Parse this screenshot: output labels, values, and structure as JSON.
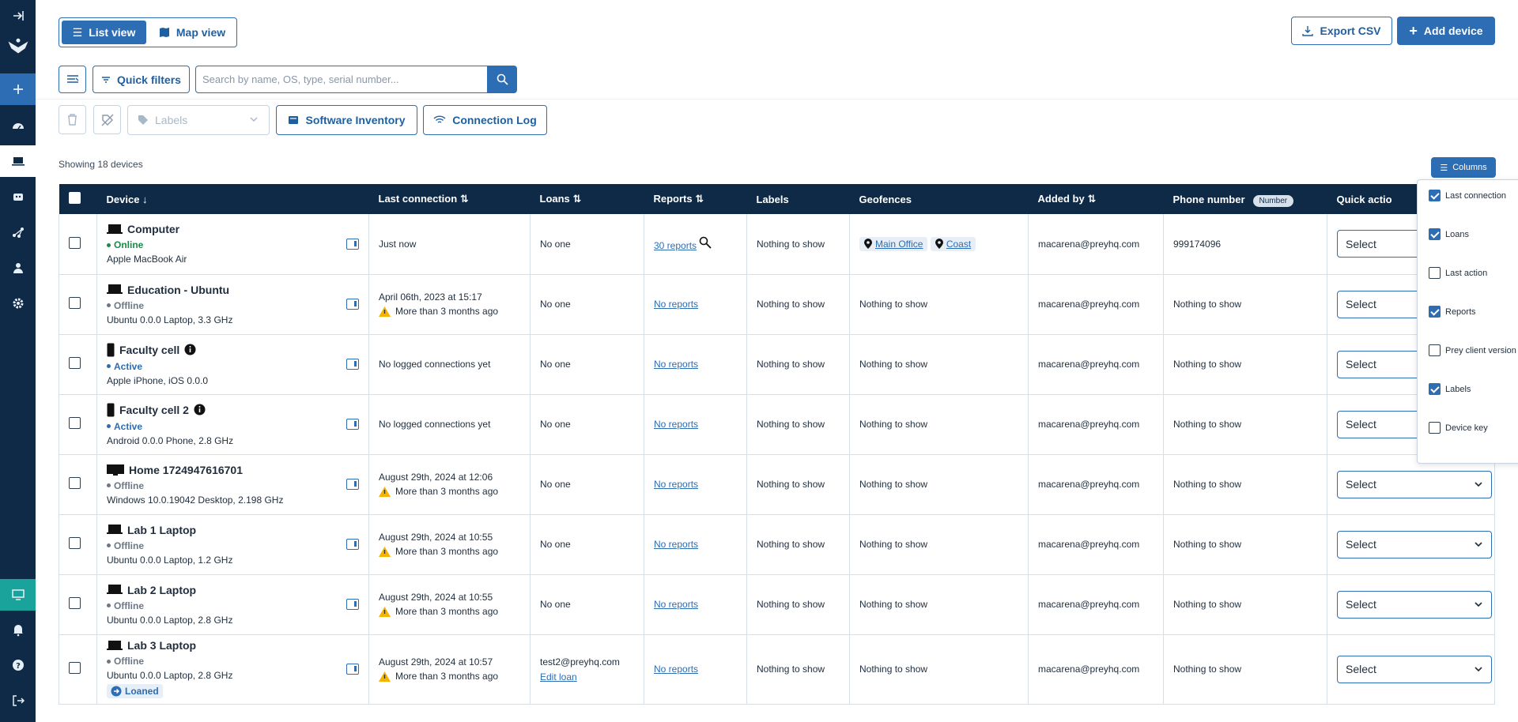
{
  "top": {
    "list_view": "List view",
    "map_view": "Map view",
    "export_csv": "Export CSV",
    "add_device": "Add device"
  },
  "toolbar": {
    "quick_filters": "Quick filters",
    "search_placeholder": "Search by name, OS, type, serial number...",
    "labels_placeholder": "Labels",
    "software_inventory": "Software Inventory",
    "connection_log": "Connection Log"
  },
  "showing": "Showing 18 devices",
  "columns_button": "Columns",
  "headers": {
    "device": "Device",
    "last_connection": "Last connection",
    "loans": "Loans",
    "reports": "Reports",
    "labels": "Labels",
    "geofences": "Geofences",
    "added_by": "Added by",
    "phone_number": "Phone number",
    "number_badge": "Number",
    "quick_actions": "Quick actio"
  },
  "rows": [
    {
      "name": "Computer",
      "status": "Online",
      "model": "Apple MacBook Air",
      "last": "Just now",
      "last_sub": "",
      "loans": "No one",
      "loans_link": "",
      "reports": "30 reports",
      "labels": "Nothing to show",
      "geo1": "Main Office",
      "geo2": "Coast",
      "added": "macarena@preyhq.com",
      "phone": "999174096",
      "select": "Select"
    },
    {
      "name": "Education - Ubuntu",
      "status": "Offline",
      "model": "Ubuntu 0.0.0 Laptop, 3.3 GHz",
      "last": "April 06th, 2023 at 15:17",
      "last_sub": "More than 3 months ago",
      "loans": "No one",
      "loans_link": "",
      "reports": "No reports",
      "labels": "Nothing to show",
      "geo": "Nothing to show",
      "added": "macarena@preyhq.com",
      "phone": "Nothing to show",
      "select": "Select"
    },
    {
      "name": "Faculty cell",
      "status": "Active",
      "model": "Apple iPhone, iOS 0.0.0",
      "last": "No logged connections yet",
      "last_sub": "",
      "loans": "No one",
      "loans_link": "",
      "reports": "No reports",
      "labels": "Nothing to show",
      "geo": "Nothing to show",
      "added": "macarena@preyhq.com",
      "phone": "Nothing to show",
      "select": "Select"
    },
    {
      "name": "Faculty cell 2",
      "status": "Active",
      "model": "Android 0.0.0 Phone, 2.8 GHz",
      "last": "No logged connections yet",
      "last_sub": "",
      "loans": "No one",
      "loans_link": "",
      "reports": "No reports",
      "labels": "Nothing to show",
      "geo": "Nothing to show",
      "added": "macarena@preyhq.com",
      "phone": "Nothing to show",
      "select": "Select"
    },
    {
      "name": "Home 1724947616701",
      "status": "Offline",
      "model": "Windows 10.0.19042 Desktop, 2.198 GHz",
      "last": "August 29th, 2024 at 12:06",
      "last_sub": "More than 3 months ago",
      "loans": "No one",
      "loans_link": "",
      "reports": "No reports",
      "labels": "Nothing to show",
      "geo": "Nothing to show",
      "added": "macarena@preyhq.com",
      "phone": "Nothing to show",
      "select": "Select"
    },
    {
      "name": "Lab 1 Laptop",
      "status": "Offline",
      "model": "Ubuntu 0.0.0 Laptop, 1.2 GHz",
      "last": "August 29th, 2024 at 10:55",
      "last_sub": "More than 3 months ago",
      "loans": "No one",
      "loans_link": "",
      "reports": "No reports",
      "labels": "Nothing to show",
      "geo": "Nothing to show",
      "added": "macarena@preyhq.com",
      "phone": "Nothing to show",
      "select": "Select"
    },
    {
      "name": "Lab 2 Laptop",
      "status": "Offline",
      "model": "Ubuntu 0.0.0 Laptop, 2.8 GHz",
      "last": "August 29th, 2024 at 10:55",
      "last_sub": "More than 3 months ago",
      "loans": "No one",
      "loans_link": "",
      "reports": "No reports",
      "labels": "Nothing to show",
      "geo": "Nothing to show",
      "added": "macarena@preyhq.com",
      "phone": "Nothing to show",
      "select": "Select"
    },
    {
      "name": "Lab 3 Laptop",
      "status": "Offline",
      "model": "Ubuntu 0.0.0 Laptop, 2.8 GHz",
      "loaned": "Loaned",
      "last": "August 29th, 2024 at 10:57",
      "last_sub": "More than 3 months ago",
      "loans": "test2@preyhq.com",
      "loans_link": "Edit loan",
      "reports": "No reports",
      "labels": "Nothing to show",
      "geo": "Nothing to show",
      "added": "macarena@preyhq.com",
      "phone": "Nothing to show",
      "select": "Select"
    }
  ],
  "column_menu": [
    {
      "label": "Last connection",
      "checked": true
    },
    {
      "label": "Loans",
      "checked": true
    },
    {
      "label": "Last action",
      "checked": false
    },
    {
      "label": "Reports",
      "checked": true
    },
    {
      "label": "Prey client version",
      "checked": false
    },
    {
      "label": "Labels",
      "checked": true
    },
    {
      "label": "Device key",
      "checked": false
    }
  ],
  "colors": {
    "navy": "#0f2a47",
    "accent": "#2c6db3",
    "online": "#1a8a4a",
    "warning": "#f5b400"
  }
}
